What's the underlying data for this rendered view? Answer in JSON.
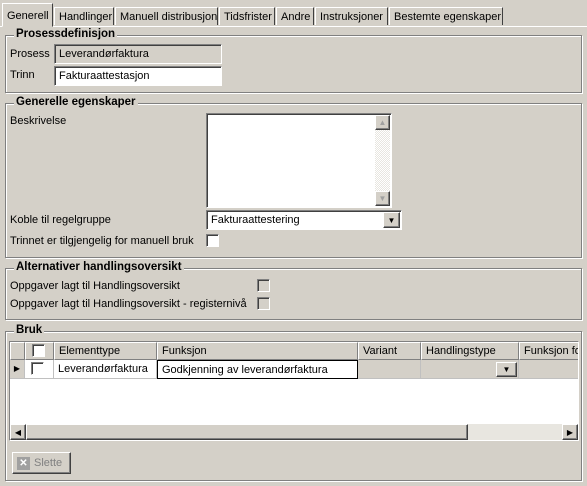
{
  "tabs": [
    "Generell",
    "Handlinger",
    "Manuell distribusjon",
    "Tidsfrister",
    "Andre",
    "Instruksjoner",
    "Bestemte egenskaper"
  ],
  "prosessdefinisjon": {
    "title": "Prosessdefinisjon",
    "prosess_label": "Prosess",
    "prosess_value": "Leverandørfaktura",
    "trinn_label": "Trinn",
    "trinn_value": "Fakturaattestasjon"
  },
  "generelle": {
    "title": "Generelle egenskaper",
    "beskrivelse_label": "Beskrivelse",
    "beskrivelse_value": "",
    "regelgruppe_label": "Koble til regelgruppe",
    "regelgruppe_value": "Fakturaattestering",
    "manuell_label": "Trinnet er tilgjengelig for manuell bruk",
    "manuell_checked": false
  },
  "alternativer": {
    "title": "Alternativer handlingsoversikt",
    "opt1_label": "Oppgaver lagt til Handlingsoversikt",
    "opt2_label": "Oppgaver lagt til Handlingsoversikt - registernivå"
  },
  "bruk": {
    "title": "Bruk",
    "columns": [
      "Elementtype",
      "Funksjon",
      "Variant",
      "Handlingstype",
      "Funksjon fo"
    ],
    "rows": [
      {
        "elementtype": "Leverandørfaktura",
        "funksjon": "Godkjenning av leverandørfaktura",
        "variant": "",
        "handlingstype": ""
      }
    ],
    "delete_label": "Slette"
  },
  "icons": {
    "row_pointer": "triangle-right-icon",
    "delete": "delete-x-icon",
    "dropdown": "chevron-down-icon"
  }
}
